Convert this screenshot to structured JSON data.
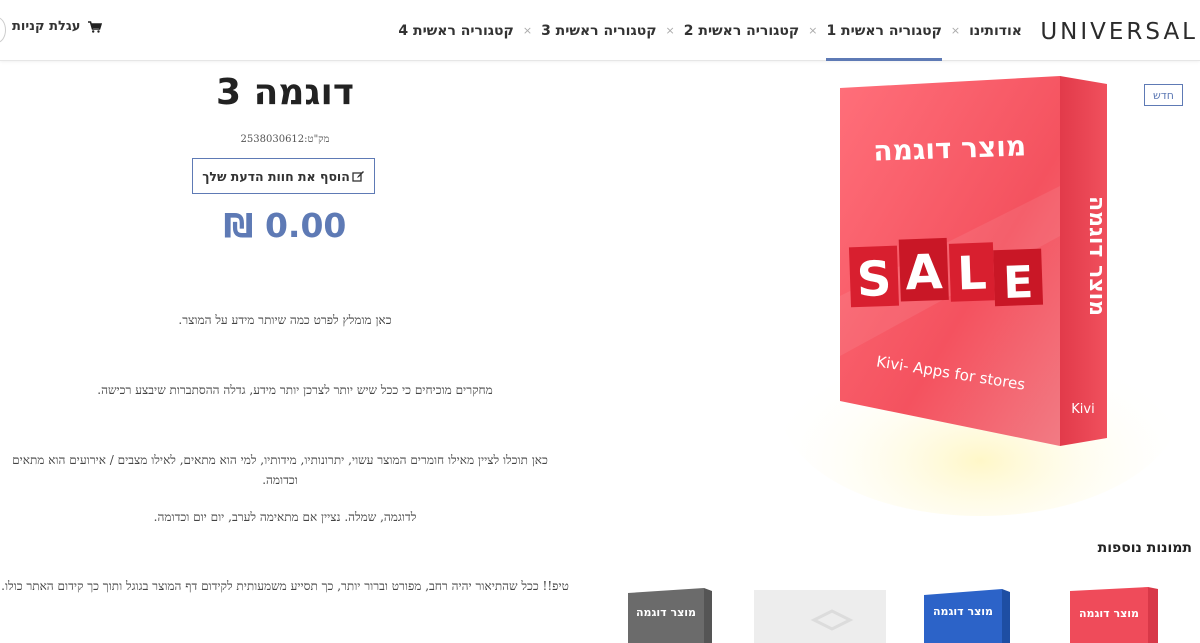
{
  "header": {
    "logo": "UNIVERSAL",
    "nav": [
      {
        "label": "אודותינו",
        "active": false
      },
      {
        "label": "קטגוריה ראשית 1",
        "active": true
      },
      {
        "label": "קטגוריה ראשית 2",
        "active": false
      },
      {
        "label": "קטגוריה ראשית 3",
        "active": false
      },
      {
        "label": "קטגוריה ראשית 4",
        "active": false
      }
    ],
    "separator": "×",
    "cart_label": "עגלת קניות"
  },
  "product": {
    "title": "דוגמה 3",
    "sku": "מק\"ט:2538030612",
    "review_button": "הוסף את חוות הדעת שלך",
    "price": "0.00 ₪",
    "badge": "חדש",
    "image": {
      "top_text": "מוצר דוגמה",
      "side_text": "מוצר דוגמה",
      "sale_letters": [
        "S",
        "A",
        "L",
        "E"
      ],
      "footer_text": "Kivi- Apps for stores",
      "corner_brand": "Kivi"
    },
    "description": [
      "כאן מומלץ לפרט כמה שיותר מידע על המוצר.",
      "מחקרים מוכיחים כי ככל שיש יותר לצרכן יותר מידע, גדלה ההסתברות שיבצע רכישה.",
      "כאן תוכלו לציין מאילו חומרים המוצר עשוי, יתרונותיו, מידותיו, למי הוא מתאים, לאילו מצבים / אירועים הוא מתאים וכדומה.",
      "לדוגמה, שמלה. נציין אם מתאימה לערב, יום יום וכדומה.",
      "טיפ!! ככל שהתיאור יהיה רחב, מפורט וברור יותר, כך תסייע משמעותית לקידום דף המוצר בגוגל ותוך כך קידום האתר כולו."
    ]
  },
  "more_images": {
    "title": "תמונות נוספות",
    "thumbs": [
      {
        "color": "#ef4b5a",
        "text": "מוצר דוגמה"
      },
      {
        "color": "#2c63c8",
        "text": "מוצר דוגמה"
      },
      {
        "color": "#e8e8e8",
        "text": ""
      },
      {
        "color": "#6b6b6b",
        "text": "מוצר דוגמה"
      }
    ]
  },
  "colors": {
    "accent": "#5e7ab5",
    "box_red": "#ef4b5a"
  }
}
